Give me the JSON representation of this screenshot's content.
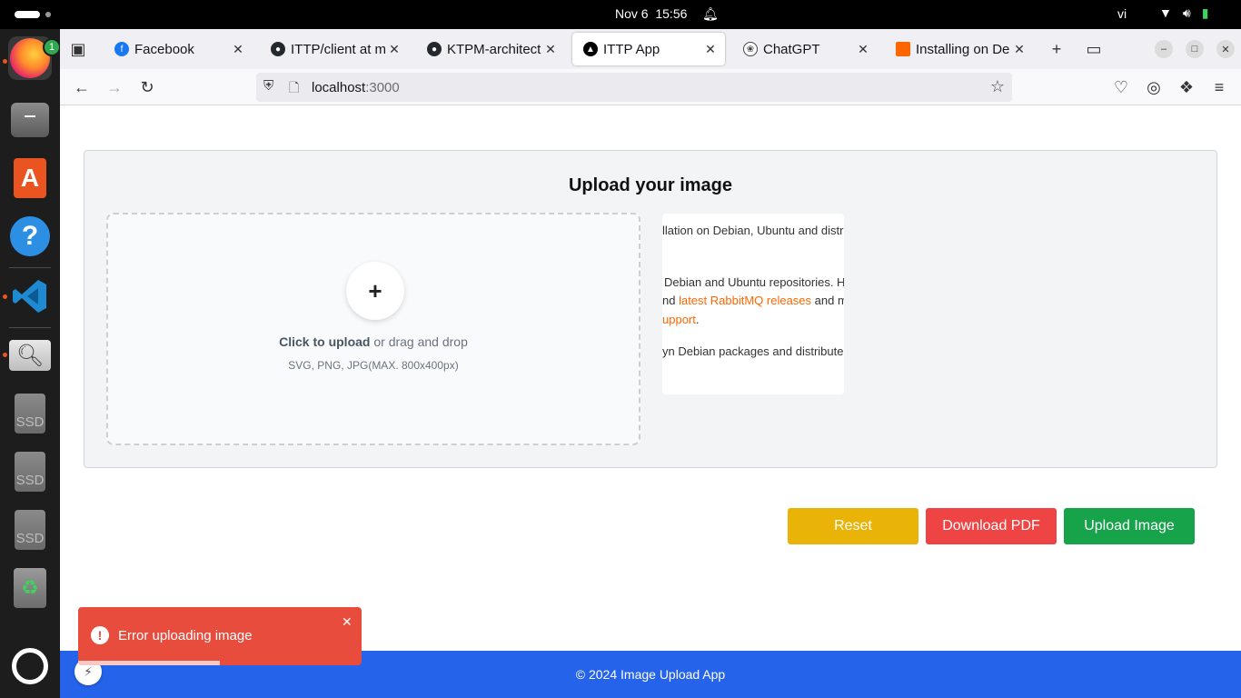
{
  "system": {
    "date": "Nov 6",
    "time": "15:56",
    "language": "vi"
  },
  "dock": {
    "firefox_badge": "1",
    "ssd_labels": [
      "SSD",
      "SSD",
      "SSD"
    ]
  },
  "browser": {
    "tabs": [
      {
        "label": "Facebook",
        "icon": "facebook-icon",
        "color": "#1877f2",
        "active": false
      },
      {
        "label": "ITTP/client at mai",
        "icon": "github-icon",
        "color": "#24292f",
        "active": false
      },
      {
        "label": "KTPM-architectur",
        "icon": "github-icon",
        "color": "#24292f",
        "active": false
      },
      {
        "label": "ITTP App",
        "icon": "nextjs-icon",
        "color": "#000000",
        "active": true
      },
      {
        "label": "ChatGPT",
        "icon": "chatgpt-icon",
        "color": "#444444",
        "active": false
      },
      {
        "label": "Installing on Debi",
        "icon": "rabbitmq-icon",
        "color": "#ff6600",
        "active": false
      }
    ],
    "url": {
      "host": "localhost",
      "port": ":3000"
    }
  },
  "page": {
    "title": "Upload your image",
    "dropzone": {
      "cta_bold": "Click to upload",
      "cta_rest": " or drag and drop",
      "hint": "SVG, PNG, JPG(MAX. 800x400px)"
    },
    "preview": {
      "line1": "llation on Debian, Ubuntu and distri",
      "line2": "Debian and Ubuntu repositories. Ho",
      "line3_pre": "nd ",
      "line3_link": "latest RabbitMQ releases",
      "line3_post": " and ma",
      "line4_link": "upport",
      "line4_post": ".",
      "line5": "yn Debian packages and distributes"
    },
    "buttons": {
      "reset": "Reset",
      "download_pdf": "Download PDF",
      "upload": "Upload Image"
    },
    "footer": "© 2024 Image Upload App"
  },
  "toast": {
    "message": "Error uploading image",
    "progress": 0.5
  },
  "colors": {
    "reset": "#eab308",
    "download_pdf": "#ef4444",
    "upload": "#16a34a",
    "footer": "#2563eb",
    "toast": "#e74c3c"
  }
}
